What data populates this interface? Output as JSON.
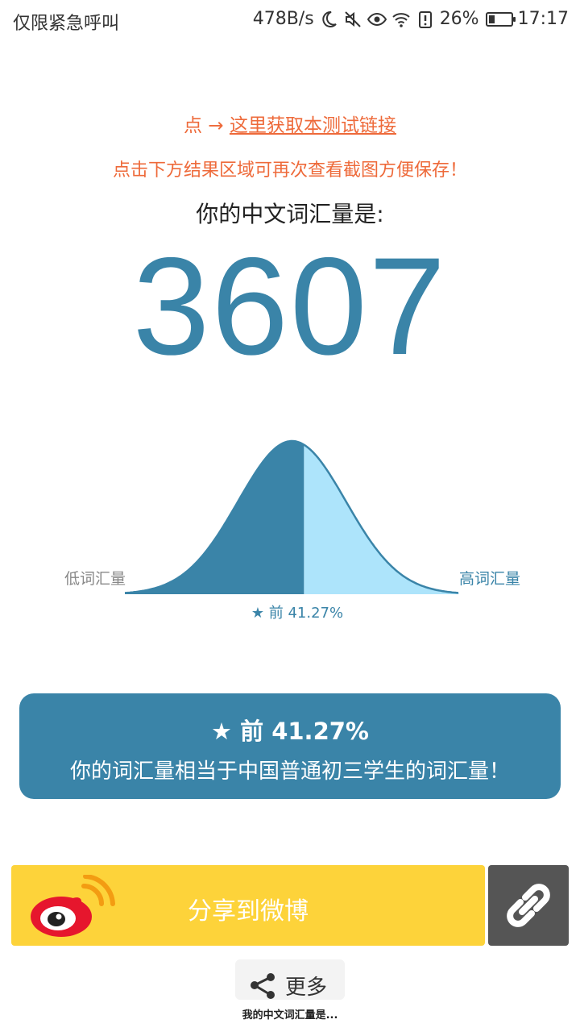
{
  "status_bar": {
    "left_text": "仅限紧急呼叫",
    "net_speed": "478B/s",
    "battery": "26%",
    "battery_level": 0.26,
    "time": "17:17",
    "icons": [
      "moon-icon",
      "mute-icon",
      "eye-icon",
      "wifi-icon",
      "battery-alert-icon",
      "battery-icon"
    ]
  },
  "link_line": {
    "prefix": "点 → ",
    "link_text": "这里获取本测试链接"
  },
  "hint": "点击下方结果区域可再次查看截图方便保存！",
  "result": {
    "label": "你的中文词汇量是:",
    "value": "3607"
  },
  "chart_data": {
    "type": "area",
    "title": "",
    "left_label": "低词汇量",
    "right_label": "高词汇量",
    "marker_label": "★ 前 41.27%",
    "percentile": 41.27,
    "curve": "normal-distribution",
    "colors": {
      "filled": "#3a84a8",
      "remaining": "#ade4fb",
      "outline": "#3a84a8"
    }
  },
  "card": {
    "rank": "★ 前 41.27%",
    "description": "你的词汇量相当于中国普通初三学生的词汇量！"
  },
  "share": {
    "weibo_label": "分享到微博",
    "more_label": "更多",
    "icons": [
      "weibo-logo-icon",
      "link-icon",
      "share-icon"
    ]
  },
  "footer": "我的中文词汇量是..."
}
